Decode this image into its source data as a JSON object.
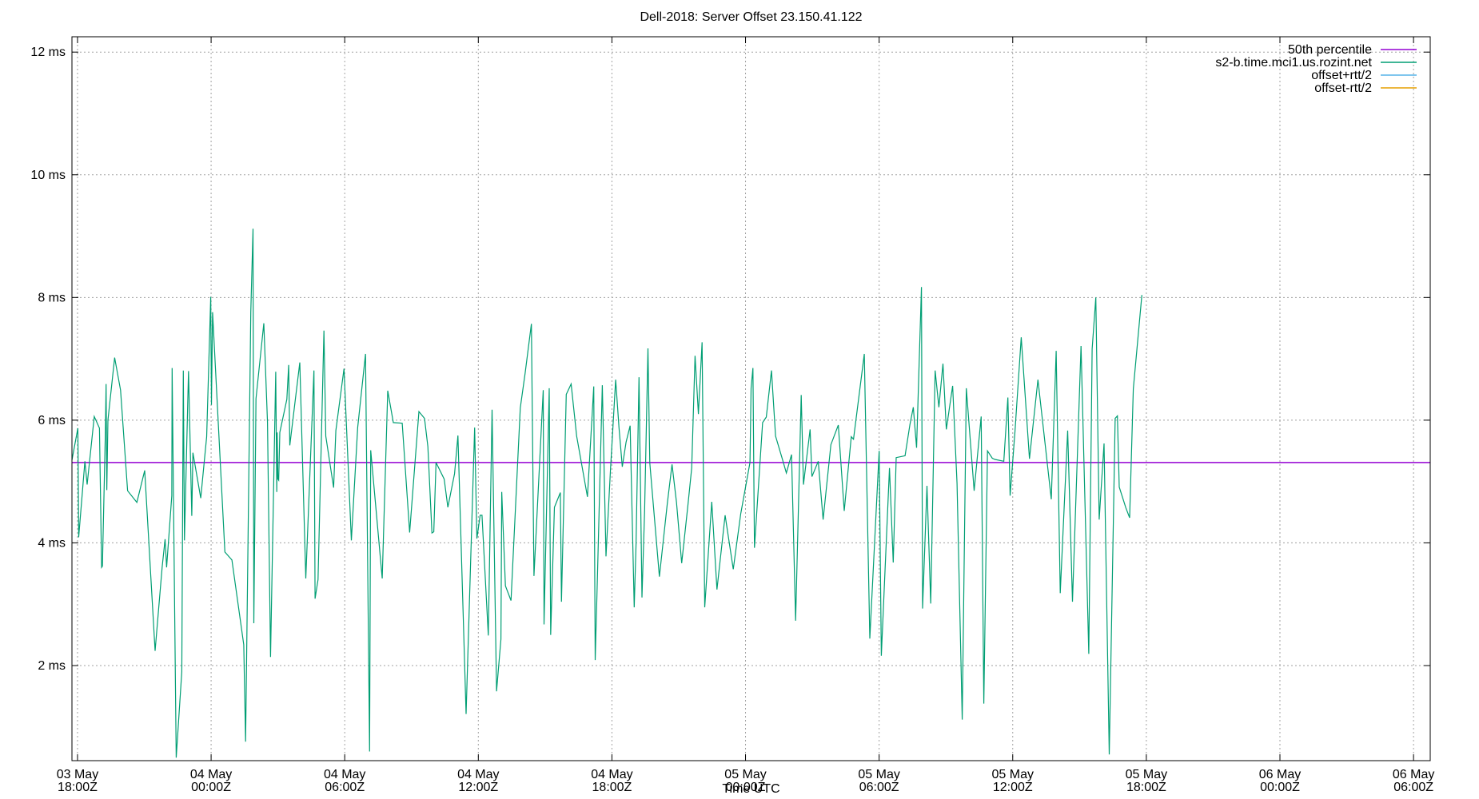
{
  "chart_data": {
    "type": "line",
    "title": "Dell-2018: Server Offset 23.150.41.122",
    "xlabel": "Time UTC",
    "ylabel": "",
    "y_unit": "ms",
    "ylim": [
      0.45,
      12.25
    ],
    "yticks": [
      {
        "value": 2,
        "label": "2 ms"
      },
      {
        "value": 4,
        "label": "4 ms"
      },
      {
        "value": 6,
        "label": "6 ms"
      },
      {
        "value": 8,
        "label": "8 ms"
      },
      {
        "value": 10,
        "label": "10 ms"
      },
      {
        "value": 12,
        "label": "12 ms"
      }
    ],
    "xlim": [
      "2024-05-03T17:45Z",
      "2024-05-06T06:45Z"
    ],
    "xticks": [
      {
        "value": "2024-05-03T18:00Z",
        "line1": "03 May",
        "line2": "18:00Z"
      },
      {
        "value": "2024-05-04T00:00Z",
        "line1": "04 May",
        "line2": "00:00Z"
      },
      {
        "value": "2024-05-04T06:00Z",
        "line1": "04 May",
        "line2": "06:00Z"
      },
      {
        "value": "2024-05-04T12:00Z",
        "line1": "04 May",
        "line2": "12:00Z"
      },
      {
        "value": "2024-05-04T18:00Z",
        "line1": "04 May",
        "line2": "18:00Z"
      },
      {
        "value": "2024-05-05T00:00Z",
        "line1": "05 May",
        "line2": "00:00Z"
      },
      {
        "value": "2024-05-05T06:00Z",
        "line1": "05 May",
        "line2": "06:00Z"
      },
      {
        "value": "2024-05-05T12:00Z",
        "line1": "05 May",
        "line2": "12:00Z"
      },
      {
        "value": "2024-05-05T18:00Z",
        "line1": "05 May",
        "line2": "18:00Z"
      },
      {
        "value": "2024-05-06T00:00Z",
        "line1": "06 May",
        "line2": "00:00Z"
      },
      {
        "value": "2024-05-06T06:00Z",
        "line1": "06 May",
        "line2": "06:00Z"
      }
    ],
    "grid": true,
    "legend_position": "top-right",
    "series": [
      {
        "name": "50th percentile",
        "color": "#9400d3",
        "kind": "hline",
        "value": 5.31
      },
      {
        "name": "s2-b.time.mci1.us.rozint.net",
        "color": "#009e73",
        "kind": "line",
        "points": [
          [
            "2024-05-03T17:45Z",
            5.35
          ],
          [
            "2024-05-03T18:01Z",
            5.87
          ],
          [
            "2024-05-03T18:03Z",
            4.09
          ],
          [
            "2024-05-03T18:20Z",
            5.33
          ],
          [
            "2024-05-03T18:26Z",
            4.95
          ],
          [
            "2024-05-03T18:45Z",
            6.06
          ],
          [
            "2024-05-03T18:59Z",
            5.87
          ],
          [
            "2024-05-03T19:05Z",
            3.6
          ],
          [
            "2024-05-03T19:07Z",
            3.62
          ],
          [
            "2024-05-03T19:15Z",
            5.8
          ],
          [
            "2024-05-03T19:17Z",
            6.59
          ],
          [
            "2024-05-03T19:19Z",
            4.86
          ],
          [
            "2024-05-03T19:22Z",
            6.0
          ],
          [
            "2024-05-03T19:40Z",
            7.02
          ],
          [
            "2024-05-03T19:56Z",
            6.49
          ],
          [
            "2024-05-03T20:15Z",
            4.85
          ],
          [
            "2024-05-03T20:40Z",
            4.66
          ],
          [
            "2024-05-03T21:01Z",
            5.18
          ],
          [
            "2024-05-03T21:29Z",
            2.24
          ],
          [
            "2024-05-03T21:48Z",
            3.6
          ],
          [
            "2024-05-03T21:56Z",
            4.06
          ],
          [
            "2024-05-03T22:00Z",
            3.6
          ],
          [
            "2024-05-03T22:14Z",
            4.77
          ],
          [
            "2024-05-03T22:15Z",
            6.85
          ],
          [
            "2024-05-03T22:26Z",
            0.5
          ],
          [
            "2024-05-03T22:41Z",
            1.9
          ],
          [
            "2024-05-03T22:45Z",
            6.81
          ],
          [
            "2024-05-03T22:48Z",
            4.04
          ],
          [
            "2024-05-03T22:59Z",
            6.8
          ],
          [
            "2024-05-03T23:08Z",
            4.44
          ],
          [
            "2024-05-03T23:11Z",
            5.47
          ],
          [
            "2024-05-03T23:32Z",
            4.73
          ],
          [
            "2024-05-03T23:48Z",
            5.73
          ],
          [
            "2024-05-03T23:59Z",
            8.01
          ],
          [
            "2024-05-04T00:01Z",
            6.25
          ],
          [
            "2024-05-04T00:04Z",
            7.76
          ],
          [
            "2024-05-04T00:37Z",
            3.85
          ],
          [
            "2024-05-04T00:56Z",
            3.72
          ],
          [
            "2024-05-04T01:28Z",
            2.34
          ],
          [
            "2024-05-04T01:33Z",
            0.76
          ],
          [
            "2024-05-04T01:47Z",
            7.76
          ],
          [
            "2024-05-04T01:53Z",
            9.12
          ],
          [
            "2024-05-04T01:55Z",
            2.69
          ],
          [
            "2024-05-04T02:01Z",
            6.35
          ],
          [
            "2024-05-04T02:22Z",
            7.58
          ],
          [
            "2024-05-04T02:32Z",
            5.96
          ],
          [
            "2024-05-04T02:40Z",
            2.14
          ],
          [
            "2024-05-04T02:54Z",
            6.79
          ],
          [
            "2024-05-04T02:57Z",
            4.83
          ],
          [
            "2024-05-04T02:58Z",
            5.8
          ],
          [
            "2024-05-04T03:00Z",
            5.04
          ],
          [
            "2024-05-04T03:02Z",
            5.02
          ],
          [
            "2024-05-04T03:05Z",
            5.8
          ],
          [
            "2024-05-04T03:24Z",
            6.34
          ],
          [
            "2024-05-04T03:29Z",
            6.9
          ],
          [
            "2024-05-04T03:32Z",
            5.59
          ],
          [
            "2024-05-04T03:59Z",
            6.94
          ],
          [
            "2024-05-04T04:15Z",
            3.42
          ],
          [
            "2024-05-04T04:37Z",
            6.81
          ],
          [
            "2024-05-04T04:40Z",
            3.09
          ],
          [
            "2024-05-04T04:48Z",
            3.4
          ],
          [
            "2024-05-04T05:04Z",
            7.46
          ],
          [
            "2024-05-04T05:09Z",
            5.74
          ],
          [
            "2024-05-04T05:30Z",
            4.9
          ],
          [
            "2024-05-04T05:36Z",
            5.83
          ],
          [
            "2024-05-04T05:58Z",
            6.84
          ],
          [
            "2024-05-04T06:18Z",
            4.04
          ],
          [
            "2024-05-04T06:35Z",
            5.88
          ],
          [
            "2024-05-04T06:56Z",
            7.08
          ],
          [
            "2024-05-04T07:07Z",
            0.6
          ],
          [
            "2024-05-04T07:10Z",
            5.51
          ],
          [
            "2024-05-04T07:41Z",
            3.42
          ],
          [
            "2024-05-04T07:56Z",
            6.48
          ],
          [
            "2024-05-04T08:11Z",
            5.96
          ],
          [
            "2024-05-04T08:35Z",
            5.95
          ],
          [
            "2024-05-04T08:55Z",
            4.17
          ],
          [
            "2024-05-04T09:20Z",
            6.14
          ],
          [
            "2024-05-04T09:35Z",
            6.03
          ],
          [
            "2024-05-04T09:44Z",
            5.57
          ],
          [
            "2024-05-04T09:55Z",
            4.16
          ],
          [
            "2024-05-04T10:00Z",
            4.18
          ],
          [
            "2024-05-04T10:06Z",
            5.31
          ],
          [
            "2024-05-04T10:28Z",
            5.04
          ],
          [
            "2024-05-04T10:38Z",
            4.58
          ],
          [
            "2024-05-04T10:56Z",
            5.13
          ],
          [
            "2024-05-04T11:05Z",
            5.75
          ],
          [
            "2024-05-04T11:27Z",
            1.21
          ],
          [
            "2024-05-04T11:50Z",
            5.88
          ],
          [
            "2024-05-04T11:56Z",
            4.07
          ],
          [
            "2024-05-04T12:05Z",
            4.45
          ],
          [
            "2024-05-04T12:10Z",
            4.45
          ],
          [
            "2024-05-04T12:27Z",
            2.49
          ],
          [
            "2024-05-04T12:37Z",
            6.17
          ],
          [
            "2024-05-04T12:49Z",
            1.58
          ],
          [
            "2024-05-04T13:01Z",
            2.43
          ],
          [
            "2024-05-04T13:03Z",
            4.83
          ],
          [
            "2024-05-04T13:13Z",
            3.3
          ],
          [
            "2024-05-04T13:28Z",
            3.06
          ],
          [
            "2024-05-04T13:53Z",
            6.2
          ],
          [
            "2024-05-04T14:06Z",
            6.76
          ],
          [
            "2024-05-04T14:23Z",
            7.57
          ],
          [
            "2024-05-04T14:30Z",
            3.46
          ],
          [
            "2024-05-04T14:55Z",
            6.49
          ],
          [
            "2024-05-04T14:57Z",
            2.67
          ],
          [
            "2024-05-04T15:11Z",
            6.52
          ],
          [
            "2024-05-04T15:15Z",
            2.5
          ],
          [
            "2024-05-04T15:25Z",
            4.58
          ],
          [
            "2024-05-04T15:41Z",
            4.82
          ],
          [
            "2024-05-04T15:44Z",
            3.04
          ],
          [
            "2024-05-04T15:57Z",
            6.42
          ],
          [
            "2024-05-04T16:10Z",
            6.59
          ],
          [
            "2024-05-04T16:25Z",
            5.74
          ],
          [
            "2024-05-04T16:54Z",
            4.75
          ],
          [
            "2024-05-04T17:11Z",
            6.55
          ],
          [
            "2024-05-04T17:15Z",
            2.09
          ],
          [
            "2024-05-04T17:21Z",
            3.45
          ],
          [
            "2024-05-04T17:34Z",
            6.57
          ],
          [
            "2024-05-04T17:44Z",
            3.78
          ],
          [
            "2024-05-04T17:56Z",
            5.19
          ],
          [
            "2024-05-04T18:10Z",
            6.66
          ],
          [
            "2024-05-04T18:19Z",
            5.89
          ],
          [
            "2024-05-04T18:28Z",
            5.24
          ],
          [
            "2024-05-04T18:38Z",
            5.64
          ],
          [
            "2024-05-04T18:49Z",
            5.91
          ],
          [
            "2024-05-04T19:00Z",
            2.95
          ],
          [
            "2024-05-04T19:05Z",
            3.98
          ],
          [
            "2024-05-04T19:13Z",
            6.7
          ],
          [
            "2024-05-04T19:21Z",
            3.11
          ],
          [
            "2024-05-04T19:28Z",
            4.52
          ],
          [
            "2024-05-04T19:37Z",
            7.17
          ],
          [
            "2024-05-04T19:42Z",
            5.3
          ],
          [
            "2024-05-04T20:08Z",
            3.45
          ],
          [
            "2024-05-04T20:29Z",
            4.63
          ],
          [
            "2024-05-04T20:42Z",
            5.28
          ],
          [
            "2024-05-04T20:54Z",
            4.66
          ],
          [
            "2024-05-04T21:08Z",
            3.67
          ],
          [
            "2024-05-04T21:25Z",
            4.63
          ],
          [
            "2024-05-04T21:35Z",
            5.22
          ],
          [
            "2024-05-04T21:44Z",
            7.05
          ],
          [
            "2024-05-04T21:53Z",
            6.1
          ],
          [
            "2024-05-04T22:03Z",
            7.27
          ],
          [
            "2024-05-04T22:10Z",
            2.95
          ],
          [
            "2024-05-04T22:29Z",
            4.67
          ],
          [
            "2024-05-04T22:43Z",
            3.24
          ],
          [
            "2024-05-04T23:05Z",
            4.45
          ],
          [
            "2024-05-04T23:27Z",
            3.57
          ],
          [
            "2024-05-04T23:47Z",
            4.47
          ],
          [
            "2024-05-05T00:12Z",
            5.31
          ],
          [
            "2024-05-05T00:15Z",
            6.52
          ],
          [
            "2024-05-05T00:20Z",
            6.85
          ],
          [
            "2024-05-05T00:24Z",
            3.92
          ],
          [
            "2024-05-05T00:46Z",
            5.96
          ],
          [
            "2024-05-05T00:56Z",
            6.05
          ],
          [
            "2024-05-05T01:10Z",
            6.81
          ],
          [
            "2024-05-05T01:21Z",
            5.74
          ],
          [
            "2024-05-05T01:39Z",
            5.37
          ],
          [
            "2024-05-05T01:50Z",
            5.14
          ],
          [
            "2024-05-05T02:04Z",
            5.44
          ],
          [
            "2024-05-05T02:15Z",
            2.73
          ],
          [
            "2024-05-05T02:30Z",
            6.41
          ],
          [
            "2024-05-05T02:36Z",
            4.95
          ],
          [
            "2024-05-05T02:54Z",
            5.85
          ],
          [
            "2024-05-05T02:59Z",
            5.08
          ],
          [
            "2024-05-05T03:16Z",
            5.33
          ],
          [
            "2024-05-05T03:29Z",
            4.38
          ],
          [
            "2024-05-05T03:50Z",
            5.6
          ],
          [
            "2024-05-05T04:10Z",
            5.92
          ],
          [
            "2024-05-05T04:26Z",
            4.52
          ],
          [
            "2024-05-05T04:45Z",
            5.73
          ],
          [
            "2024-05-05T04:51Z",
            5.69
          ],
          [
            "2024-05-05T05:20Z",
            7.08
          ],
          [
            "2024-05-05T05:35Z",
            2.44
          ],
          [
            "2024-05-05T06:00Z",
            5.5
          ],
          [
            "2024-05-05T06:06Z",
            2.16
          ],
          [
            "2024-05-05T06:28Z",
            5.22
          ],
          [
            "2024-05-05T06:38Z",
            3.68
          ],
          [
            "2024-05-05T06:46Z",
            5.39
          ],
          [
            "2024-05-05T07:10Z",
            5.42
          ],
          [
            "2024-05-05T07:23Z",
            5.93
          ],
          [
            "2024-05-05T07:32Z",
            6.21
          ],
          [
            "2024-05-05T07:41Z",
            5.55
          ],
          [
            "2024-05-05T07:54Z",
            8.17
          ],
          [
            "2024-05-05T07:57Z",
            2.93
          ],
          [
            "2024-05-05T08:09Z",
            4.93
          ],
          [
            "2024-05-05T08:19Z",
            3.01
          ],
          [
            "2024-05-05T08:31Z",
            6.81
          ],
          [
            "2024-05-05T08:41Z",
            6.21
          ],
          [
            "2024-05-05T08:52Z",
            6.92
          ],
          [
            "2024-05-05T09:01Z",
            5.85
          ],
          [
            "2024-05-05T09:18Z",
            6.56
          ],
          [
            "2024-05-05T09:30Z",
            4.97
          ],
          [
            "2024-05-05T09:44Z",
            1.12
          ],
          [
            "2024-05-05T09:55Z",
            6.52
          ],
          [
            "2024-05-05T10:16Z",
            4.85
          ],
          [
            "2024-05-05T10:35Z",
            6.06
          ],
          [
            "2024-05-05T10:42Z",
            1.38
          ],
          [
            "2024-05-05T10:52Z",
            5.5
          ],
          [
            "2024-05-05T11:05Z",
            5.38
          ],
          [
            "2024-05-05T11:12Z",
            5.36
          ],
          [
            "2024-05-05T11:36Z",
            5.33
          ],
          [
            "2024-05-05T11:47Z",
            6.37
          ],
          [
            "2024-05-05T11:53Z",
            4.77
          ],
          [
            "2024-05-05T12:06Z",
            5.82
          ],
          [
            "2024-05-05T12:23Z",
            7.35
          ],
          [
            "2024-05-05T12:45Z",
            5.37
          ],
          [
            "2024-05-05T13:08Z",
            6.66
          ],
          [
            "2024-05-05T13:44Z",
            4.71
          ],
          [
            "2024-05-05T13:57Z",
            7.13
          ],
          [
            "2024-05-05T14:08Z",
            3.18
          ],
          [
            "2024-05-05T14:28Z",
            5.83
          ],
          [
            "2024-05-05T14:41Z",
            3.04
          ],
          [
            "2024-05-05T15:04Z",
            7.21
          ],
          [
            "2024-05-05T15:25Z",
            2.19
          ],
          [
            "2024-05-05T15:34Z",
            7.16
          ],
          [
            "2024-05-05T15:44Z",
            8.0
          ],
          [
            "2024-05-05T15:53Z",
            4.38
          ],
          [
            "2024-05-05T16:06Z",
            5.62
          ],
          [
            "2024-05-05T16:20Z",
            0.55
          ],
          [
            "2024-05-05T16:36Z",
            6.03
          ],
          [
            "2024-05-05T16:42Z",
            6.07
          ],
          [
            "2024-05-05T16:47Z",
            4.91
          ],
          [
            "2024-05-05T17:05Z",
            4.57
          ],
          [
            "2024-05-05T17:15Z",
            4.41
          ],
          [
            "2024-05-05T17:25Z",
            6.51
          ],
          [
            "2024-05-05T17:48Z",
            8.04
          ]
        ]
      },
      {
        "name": "offset+rtt/2",
        "color": "#56b4e9",
        "kind": "legend-only"
      },
      {
        "name": "offset-rtt/2",
        "color": "#e69f00",
        "kind": "legend-only"
      }
    ]
  }
}
